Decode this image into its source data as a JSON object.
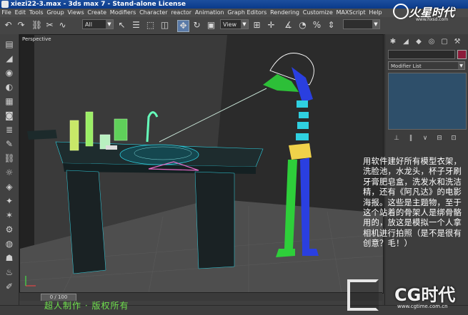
{
  "window": {
    "title": "xiezi22-3.max - 3ds max 7 - Stand-alone License"
  },
  "menu": {
    "items": [
      "File",
      "Edit",
      "Tools",
      "Group",
      "Views",
      "Create",
      "Modifiers",
      "Character",
      "reactor",
      "Animation",
      "Graph Editors",
      "Rendering",
      "Customize",
      "MAXScript",
      "Help"
    ]
  },
  "toolbar": {
    "selection_filter": "All",
    "reference_coord": "View"
  },
  "viewport": {
    "label": "Perspective"
  },
  "command_panel": {
    "modifier_list": "Modifier List"
  },
  "annotation": {
    "text": "用软件建好所有模型衣架，洗脸池，水龙头，杯子牙刷牙膏肥皂盒，洗发水和洗洁精，还有《阿凡达》的电影海报。这些是主题物，至于这个站着的骨架人是绑骨骼用的，放这是模拟一个人拿相机进行拍照（是不是很有创意？毛！）"
  },
  "timeline": {
    "frame": "0 / 100"
  },
  "credit": {
    "text": "超人制作 · 版权所有"
  },
  "logos": {
    "top_brand": "火星时代",
    "top_url": "www.hxsd.com",
    "bottom_brand": "CG时代",
    "bottom_url": "www.cgtime.com.cn"
  },
  "colors": {
    "accent": "#5a7aa8",
    "title_bar": "#0a3a8a",
    "credit": "#6fe04d",
    "wire_cyan": "#2fd0e0",
    "bone_green": "#2ecf3a",
    "bone_blue": "#2a3fe0",
    "bone_yellow": "#f0d24a"
  }
}
